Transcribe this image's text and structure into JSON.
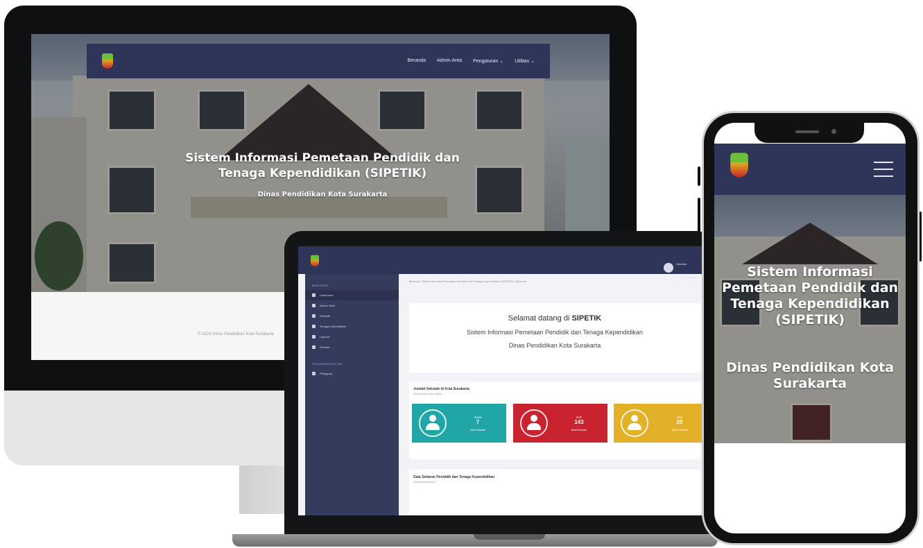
{
  "site": {
    "nav_items": [
      "Beranda",
      "Admin Area",
      "Pengaturan ⌄",
      "Utilitas ⌄"
    ],
    "hero_title": "Sistem Informasi Pemetaan Pendidik dan Tenaga Kependidikan (SIPETIK)",
    "hero_subtitle": "Dinas Pendidikan Kota Surakarta",
    "footer_text": "© 2024 Dinas Pendidikan Kota Surakarta"
  },
  "dashboard": {
    "user_name": "Operator",
    "user_role": "Dinas Pendidikan",
    "breadcrumb": "Beranda  /  Sistem Informasi Pemetaan Pendidik dan Tenaga Kependidikan (SIPETIK)  /  Beranda",
    "sidebar_heading": "MAIN MENU",
    "sidebar_items": [
      "Dashboard",
      "Master Data",
      "Pendidik",
      "Tenaga Kependidikan",
      "Laporan",
      "Sekolah"
    ],
    "sidebar_heading_2": "PENGATURAN SISTEM",
    "sidebar_items_2": [
      "Pengguna"
    ],
    "welcome_prefix": "Selamat datang di ",
    "welcome_brand": "SIPETIK",
    "welcome_line2": "Sistem Informasi Pemetaan Pendidik dan Tenaga Kependidikan",
    "welcome_line3": "Dinas Pendidikan Kota Surakarta",
    "panel1_title": "Jumlah Sekolah di Kota Surakarta",
    "panel1_subtitle": "Data sekolah tahun ajaran",
    "panel2_title": "Data Sebaran Pendidik dan Tenaga Kependidikan",
    "panel2_subtitle": "Pilih jenjang sekolah",
    "stats": [
      {
        "label": "SD/MI",
        "value": "7",
        "link": "Detail Sekolah",
        "color": "#21a6a8"
      },
      {
        "label": "SMP",
        "value": "143",
        "link": "Detail Sekolah",
        "color": "#c8232e"
      },
      {
        "label": "SMA",
        "value": "20",
        "link": "Detail Sekolah",
        "color": "#e3b127"
      }
    ]
  },
  "mobile": {
    "hero_title": "Sistem Informasi Pemetaan Pendidik dan Tenaga Kependidikan (SIPETIK)",
    "hero_subtitle": "Dinas Pendidikan Kota Surakarta"
  }
}
